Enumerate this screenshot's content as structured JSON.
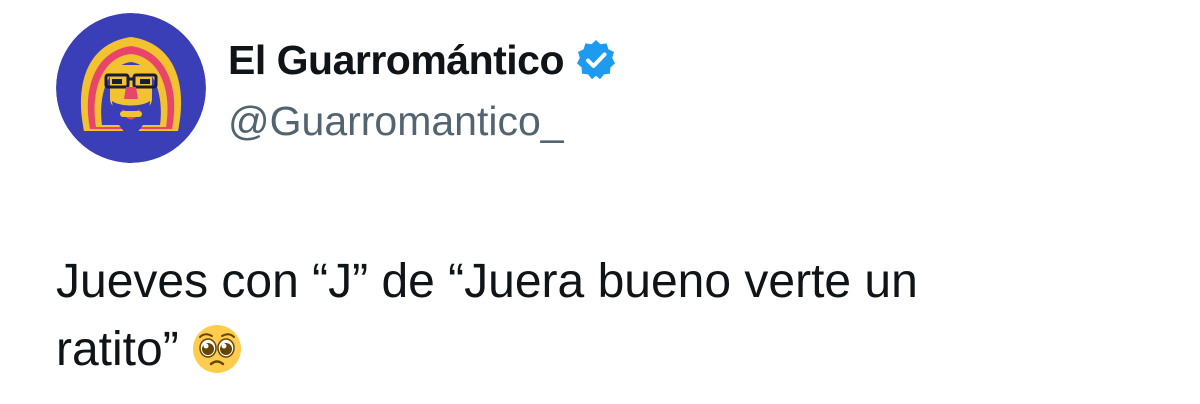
{
  "author": {
    "display_name": "El Guarromántico",
    "handle": "@Guarromantico_",
    "avatar_icon": "bearded-man-illustration-avatar",
    "verified_badge_icon": "verified-badge-icon",
    "verified_color": "#1d9bf0"
  },
  "tweet": {
    "text_line1": "Jueves con “J” de “Juera bueno verte un",
    "text_line2": "ratito”",
    "emoji_icon": "pleading-face-emoji"
  },
  "colors": {
    "name": "#0f1419",
    "handle": "#536471",
    "background": "#ffffff"
  }
}
